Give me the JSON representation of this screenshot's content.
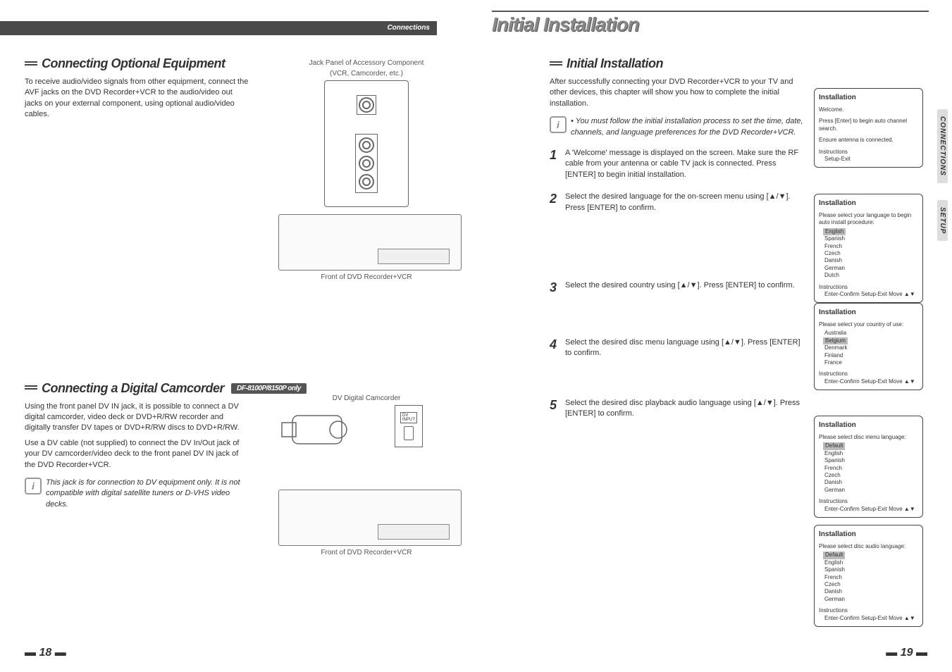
{
  "top": {
    "left_header": "Connections",
    "right_title": "Initial Installation"
  },
  "side_tabs": [
    "CONNECTIONS",
    "SETUP"
  ],
  "left_page": {
    "section1": {
      "title": "Connecting Optional Equipment",
      "body": "To receive audio/video signals from other equipment, connect the AVF jacks on the DVD Recorder+VCR to the audio/video out jacks on your external component, using optional audio/video cables.",
      "jack_caption_top": "Jack Panel of Accessory Component",
      "jack_caption_sub": "(VCR, Camcorder, etc.)",
      "front_caption": "Front of DVD Recorder+VCR"
    },
    "section2": {
      "title": "Connecting a Digital Camcorder",
      "badge": "DF-8100P/8150P only",
      "body1": "Using the front panel DV IN jack, it is possible to connect a DV digital camcorder, video deck or DVD+R/RW recorder and digitally transfer DV tapes or DVD+R/RW discs to DVD+R/RW.",
      "body2": "Use a DV cable (not supplied) to connect the DV In/Out jack of your DV camcorder/video deck to the front panel DV IN jack of the DVD Recorder+VCR.",
      "note": "This jack is for connection to DV equipment only. It is not compatible with digital satellite tuners or D-VHS video decks.",
      "dv_caption": "DV Digital Camcorder",
      "front_caption": "Front of DVD Recorder+VCR"
    }
  },
  "right_page": {
    "title": "Initial Installation",
    "intro": "After successfully connecting your DVD Recorder+VCR to your TV and other devices, this chapter will show you how to complete the initial installation.",
    "bullet": "You must follow the initial installation process to set the time, date, channels, and language preferences for the DVD Recorder+VCR.",
    "steps": [
      {
        "n": "1",
        "text": "A 'Welcome' message is displayed on the screen. Make sure the RF cable from your antenna or cable TV jack is connected. Press [ENTER] to begin initial installation."
      },
      {
        "n": "2",
        "text": "Select the desired language for the on-screen menu using [▲/▼]. Press [ENTER] to confirm."
      },
      {
        "n": "3",
        "text": "Select the desired country using [▲/▼]. Press [ENTER] to confirm."
      },
      {
        "n": "4",
        "text": "Select the desired disc menu language using [▲/▼]. Press [ENTER] to confirm."
      },
      {
        "n": "5",
        "text": "Select the desired disc playback audio language using [▲/▼]. Press [ENTER] to confirm."
      }
    ],
    "osd": [
      {
        "title": "Installation",
        "pre": "Welcome.",
        "lines": [
          "Press [Enter] to begin auto channel search.",
          "Ensure antenna is connected."
        ],
        "foot": "Instructions",
        "foot2": "Setup-Exit"
      },
      {
        "title": "Installation",
        "pre": "Please select your language to begin auto install procedure:",
        "opts": [
          "English",
          "Spanish",
          "French",
          "Czech",
          "Danish",
          "German",
          "Dutch"
        ],
        "sel": 0,
        "foot": "Instructions",
        "foot2": "Enter-Confirm   Setup-Exit   Move ▲▼"
      },
      {
        "title": "Installation",
        "pre": "Please select your country of use:",
        "opts": [
          "Australia",
          "Belgium",
          "Denmark",
          "Finland",
          "France"
        ],
        "sel": 1,
        "foot": "Instructions",
        "foot2": "Enter-Confirm   Setup-Exit   Move ▲▼"
      },
      {
        "title": "Installation",
        "pre": "Please select disc menu language:",
        "opts": [
          "Default",
          "English",
          "Spanish",
          "French",
          "Czech",
          "Danish",
          "German"
        ],
        "sel": 0,
        "foot": "Instructions",
        "foot2": "Enter-Confirm   Setup-Exit   Move ▲▼"
      },
      {
        "title": "Installation",
        "pre": "Please select disc audio language:",
        "opts": [
          "Default",
          "English",
          "Spanish",
          "French",
          "Czech",
          "Danish",
          "German"
        ],
        "sel": 0,
        "foot": "Instructions",
        "foot2": "Enter-Confirm   Setup-Exit   Move ▲▼"
      }
    ]
  },
  "pages": {
    "left": "18",
    "right": "19"
  }
}
